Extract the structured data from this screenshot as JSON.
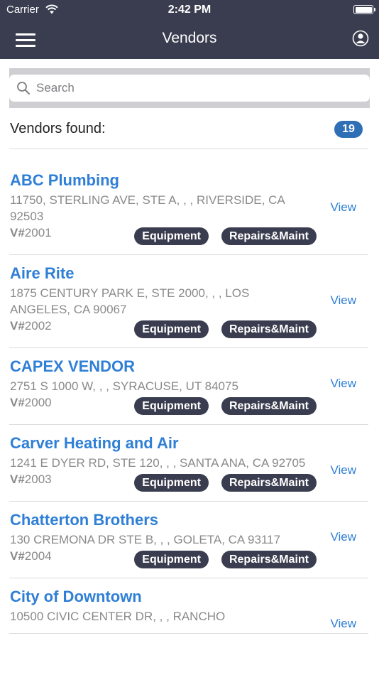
{
  "status_bar": {
    "carrier": "Carrier",
    "time": "2:42 PM"
  },
  "nav": {
    "title": "Vendors",
    "menu_icon": "hamburger-menu-icon",
    "profile_icon": "user-profile-icon"
  },
  "search": {
    "placeholder": "Search",
    "value": ""
  },
  "summary": {
    "label": "Vendors found:",
    "count": "19"
  },
  "colors": {
    "header_bg": "#3a3d4f",
    "link": "#2f7fd6",
    "badge": "#2e6fb5",
    "tag_bg": "#3a3d4f"
  },
  "vendors": [
    {
      "name": "ABC Plumbing",
      "address": "11750, STERLING AVE, STE A, , , RIVERSIDE, CA 92503",
      "number_prefix": "V#",
      "number": "2001",
      "tags": [
        "Equipment",
        "Repairs&Maint"
      ],
      "view_label": "View"
    },
    {
      "name": "Aire Rite",
      "address": "1875 CENTURY PARK E, STE 2000, , , LOS ANGELES, CA 90067",
      "number_prefix": "V#",
      "number": "2002",
      "tags": [
        "Equipment",
        "Repairs&Maint"
      ],
      "view_label": "View"
    },
    {
      "name": "CAPEX VENDOR",
      "address": "2751 S 1000 W, , , SYRACUSE, UT 84075",
      "number_prefix": "V#",
      "number": "2000",
      "tags": [
        "Equipment",
        "Repairs&Maint"
      ],
      "view_label": "View"
    },
    {
      "name": "Carver Heating and Air",
      "address": "1241 E DYER RD, STE 120, , , SANTA ANA, CA 92705",
      "number_prefix": "V#",
      "number": "2003",
      "tags": [
        "Equipment",
        "Repairs&Maint"
      ],
      "view_label": "View"
    },
    {
      "name": "Chatterton Brothers",
      "address": "130 CREMONA DR STE B, , , GOLETA, CA 93117",
      "number_prefix": "V#",
      "number": "2004",
      "tags": [
        "Equipment",
        "Repairs&Maint"
      ],
      "view_label": "View"
    },
    {
      "name": "City of Downtown",
      "address": "10500 CIVIC CENTER DR, , , RANCHO",
      "number_prefix": "",
      "number": "",
      "tags": [],
      "view_label": "View"
    }
  ]
}
